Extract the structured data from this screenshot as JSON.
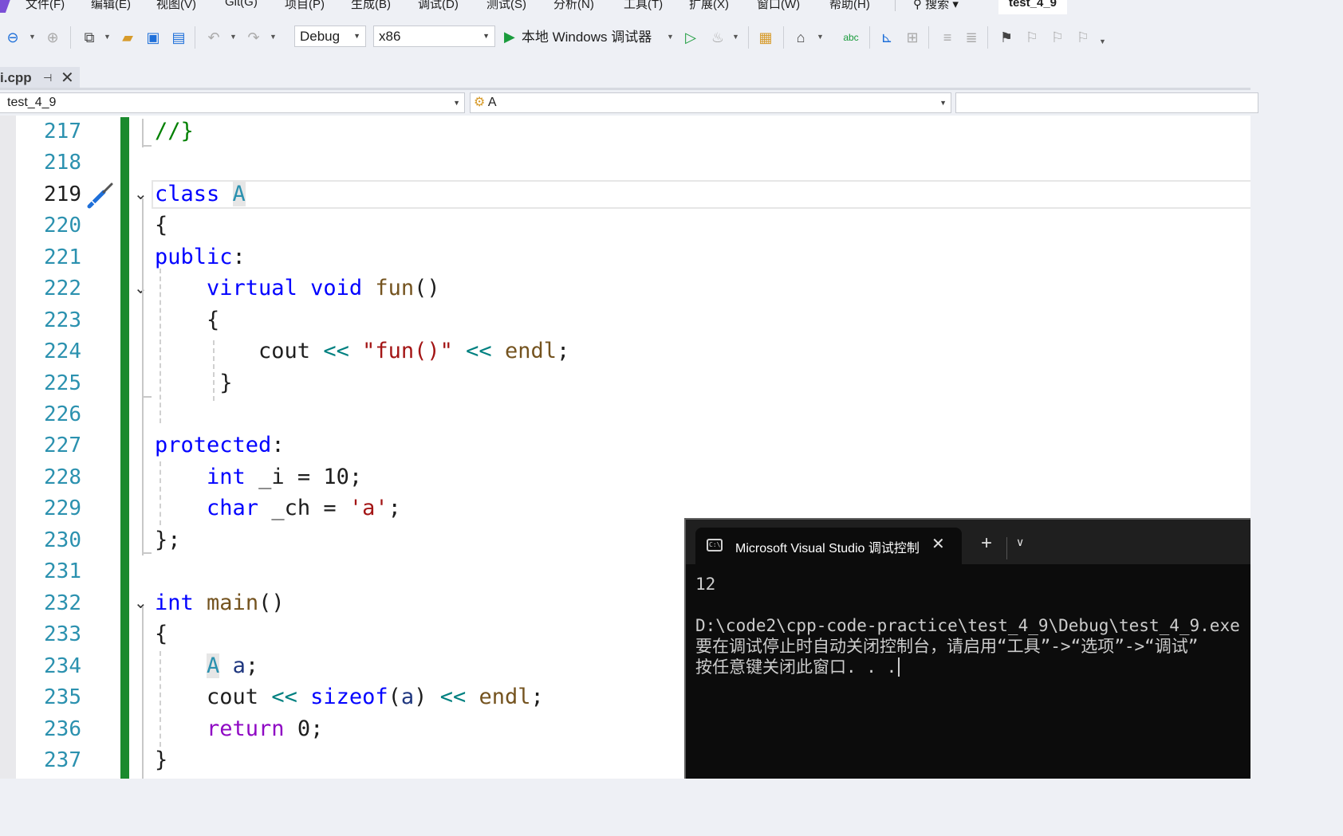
{
  "menu": {
    "items": [
      "文件(F)",
      "编辑(E)",
      "视图(V)",
      "Git(G)",
      "项目(P)",
      "生成(B)",
      "调试(D)",
      "测试(S)",
      "分析(N)",
      "工具(T)",
      "扩展(X)",
      "窗口(W)",
      "帮助(H)"
    ],
    "search_label": "搜索 ▾",
    "project_name": "test_4_9"
  },
  "toolbar": {
    "config": "Debug",
    "platform": "x86",
    "run_label": "本地 Windows 调试器"
  },
  "tab": {
    "filename": "i.cpp",
    "pin": "⊣",
    "close": "✕"
  },
  "navbar": {
    "scope": "test_4_9",
    "member": "A"
  },
  "editor": {
    "line_numbers": [
      "217",
      "218",
      "219",
      "220",
      "221",
      "222",
      "223",
      "224",
      "225",
      "226",
      "227",
      "228",
      "229",
      "230",
      "231",
      "232",
      "233",
      "234",
      "235",
      "236",
      "237"
    ],
    "current_line": "219"
  },
  "console": {
    "title": "Microsoft Visual Studio 调试控制台",
    "output_value": "12",
    "exe_path": "D:\\code2\\cpp-code-practice\\test_4_9\\Debug\\test_4_9.exe",
    "hint_line": "要在调试停止时自动关闭控制台，请启用“工具”->“选项”->“调试”",
    "press_key": "按任意键关闭此窗口. . .",
    "plus": "+",
    "close": "✕"
  },
  "colors": {
    "keyword": "#0000ff",
    "type": "#2b91af",
    "function": "#74531f",
    "string": "#a31515",
    "comment": "#008000",
    "control": "#8f08c4",
    "change_bar": "#1a8a2e"
  }
}
